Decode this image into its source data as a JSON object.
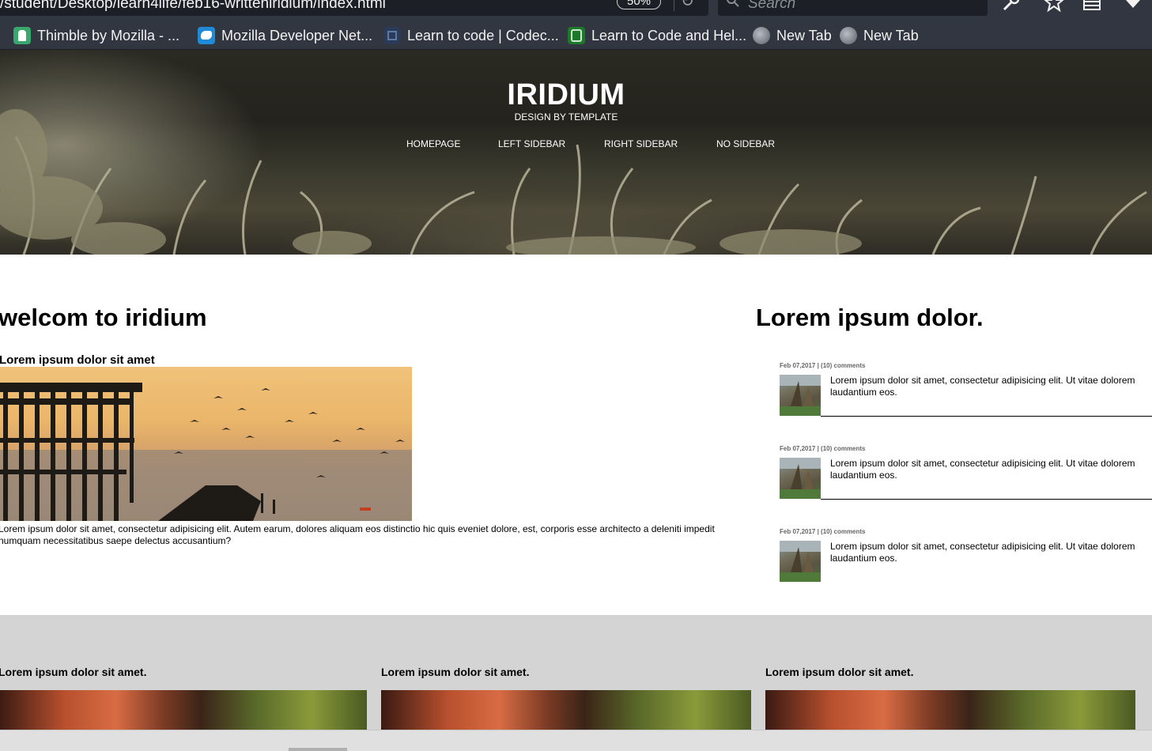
{
  "browser": {
    "url": "/student/Desktop/learn4life/feb16-writteniridium/index.html",
    "zoom": "50%",
    "search_placeholder": "Search",
    "bookmarks": [
      {
        "label": "Thimble by Mozilla - ...",
        "icon": "thimble-icon"
      },
      {
        "label": "Mozilla Developer Net...",
        "icon": "mdn-icon"
      },
      {
        "label": "Learn to code | Codec...",
        "icon": "codecademy-icon"
      },
      {
        "label": "Learn to Code and Hel...",
        "icon": "freecodecamp-icon"
      },
      {
        "label": "New Tab",
        "icon": "globe-icon"
      },
      {
        "label": "New Tab",
        "icon": "globe-icon"
      }
    ],
    "toolbar_icons": [
      "wrench-icon",
      "star-icon",
      "library-icon",
      "download-icon"
    ]
  },
  "header": {
    "title": "IRIDIUM",
    "subtitle": "DESIGN BY TEMPLATE",
    "nav": [
      "HOMEPAGE",
      "LEFT SIDEBAR",
      "RIGHT SIDEBAR",
      "NO SIDEBAR"
    ]
  },
  "main": {
    "heading": "welcom to iridium",
    "post_title": "Lorem ipsum dolor sit amet",
    "post_text": "Lorem ipsum dolor sit amet, consectetur adipisicing elit. Autem earum, dolores aliquam eos distinctio hic quis eveniet dolore, est, corporis esse architecto a deleniti impedit numquam necessitatibus saepe delectus accusantium?"
  },
  "sidebar": {
    "heading": "Lorem ipsum dolor.",
    "items": [
      {
        "meta": "Feb 07,2017 | (10) comments",
        "text": "Lorem ipsum dolor sit amet, consectetur adipisicing elit. Ut vitae dolorem laudantium eos."
      },
      {
        "meta": "Feb 07,2017 | (10) comments",
        "text": "Lorem ipsum dolor sit amet, consectetur adipisicing elit. Ut vitae dolorem laudantium eos."
      },
      {
        "meta": "Feb 07,2017 | (10) comments",
        "text": "Lorem ipsum dolor sit amet, consectetur adipisicing elit. Ut vitae dolorem laudantium eos."
      }
    ]
  },
  "footer": {
    "columns": [
      {
        "title": "Lorem ipsum dolor sit amet."
      },
      {
        "title": "Lorem ipsum dolor sit amet."
      },
      {
        "title": "Lorem ipsum dolor sit amet."
      }
    ]
  }
}
